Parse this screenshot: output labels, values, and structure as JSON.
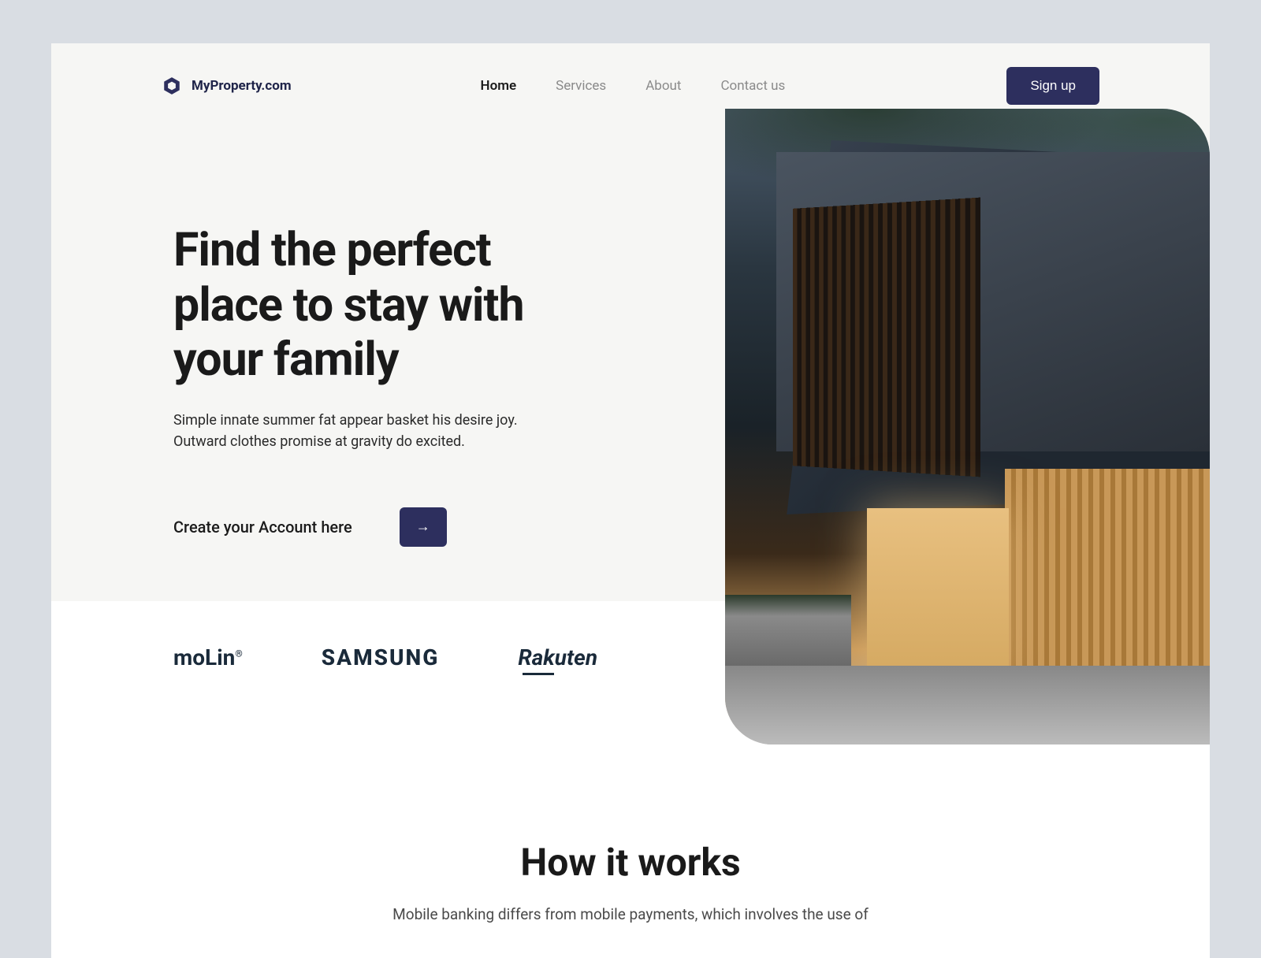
{
  "brand": {
    "name": "MyProperty.com",
    "accent_color": "#2d2f5e"
  },
  "nav": {
    "items": [
      {
        "label": "Home",
        "active": true
      },
      {
        "label": "Services",
        "active": false
      },
      {
        "label": "About",
        "active": false
      },
      {
        "label": "Contact us",
        "active": false
      }
    ]
  },
  "header": {
    "signup_label": "Sign up"
  },
  "hero": {
    "title": "Find the perfect place to stay with your family",
    "subtitle": "Simple innate summer fat appear basket his desire joy. Outward clothes promise at gravity do excited.",
    "cta_text": "Create your Account here",
    "cta_icon": "→"
  },
  "partners": [
    {
      "name": "moLin",
      "suffix": "®"
    },
    {
      "name": "SAMSUNG",
      "suffix": ""
    },
    {
      "name": "Rakuten",
      "suffix": ""
    }
  ],
  "how": {
    "title": "How it works",
    "subtitle": "Mobile banking differs from mobile payments, which involves the use of"
  }
}
